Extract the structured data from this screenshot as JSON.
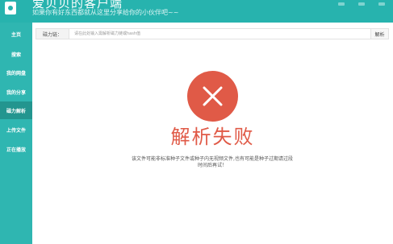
{
  "header": {
    "title": "爱贝贝的客户端",
    "subtitle": "如果你有好东西都就从这里分享给你的小伙伴吧~~"
  },
  "sidebar": {
    "items": [
      {
        "label": "主页"
      },
      {
        "label": "搜索"
      },
      {
        "label": "我的网盘"
      },
      {
        "label": "我的分享"
      },
      {
        "label": "磁力解析"
      },
      {
        "label": "上传文件"
      },
      {
        "label": "正在播放"
      }
    ],
    "active_index": 4
  },
  "search": {
    "label": "磁力链：",
    "placeholder": "请在此处输入需解析磁力链或hash值",
    "button_label": "解析"
  },
  "result": {
    "icon": "error-x-icon",
    "title": "解析失败",
    "message": "该文件可能非标准种子文件或种子内无视频文件,也有可能是种子过期请过段时间后再试！"
  },
  "colors": {
    "accent": "#27b3ae",
    "sidebar": "#2fb6b1",
    "sidebar_active": "#23958f",
    "error": "#e05a47"
  }
}
